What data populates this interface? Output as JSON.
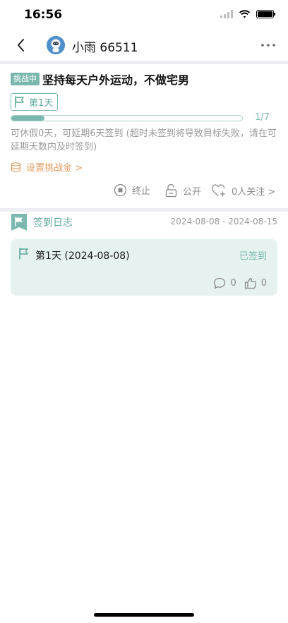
{
  "status_bar": {
    "time": "16:56"
  },
  "nav": {
    "title": "小雨 66511",
    "back_icon": "chevron-left-icon",
    "more_icon": "more-dots-icon",
    "avatar_icon": "astronaut-avatar"
  },
  "challenge": {
    "status_tag": "挑战中",
    "title": "坚持每天户外运动，不做宅男",
    "day_badge": "第1天",
    "progress": {
      "current": 1,
      "total": 7,
      "label": "1/7",
      "fraction": 0.142857
    },
    "rule_text": "可休假0天，可延期6天签到 (超时未签到将导致目标失败，请在可延期天数内及时签到)",
    "set_money_label": "设置挑战金 >",
    "actions": {
      "stop_label": "终止",
      "visibility_label": "公开",
      "follow_label": "0人关注 >"
    }
  },
  "log": {
    "title": "签到日志",
    "date_range": "2024-08-08 - 2024-08-15",
    "entries": [
      {
        "day_label": "第1天 (2024-08-08)",
        "status": "已签到",
        "comments": "0",
        "likes": "0"
      }
    ]
  },
  "colors": {
    "accent": "#7ab8ae",
    "accent_text": "#5ba699",
    "card_bg": "#e5f2ef",
    "orange": "#e39a5f",
    "gray_text": "#9a9a9a",
    "divider": "#eeedf4"
  }
}
